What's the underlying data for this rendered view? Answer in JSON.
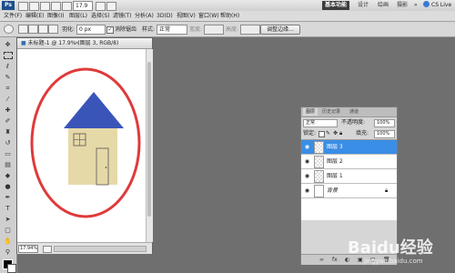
{
  "app": {
    "logo_text": "Ps",
    "zoom": "17.9",
    "workspaces": [
      "基本功能",
      "设计",
      "绘画",
      "摄影"
    ],
    "more_label": "»",
    "cs_live": "CS Live"
  },
  "menu": [
    "文件(F)",
    "编辑(E)",
    "图像(I)",
    "图层(L)",
    "选择(S)",
    "滤镜(T)",
    "分析(A)",
    "3D(D)",
    "视图(V)",
    "窗口(W)",
    "帮助(H)"
  ],
  "options": {
    "feather_label": "羽化:",
    "feather_value": "0 px",
    "antialias_label": "消除锯齿",
    "style_label": "样式:",
    "style_value": "正常",
    "width_label": "宽度:",
    "height_label": "高度:",
    "refine_label": "调整边缘..."
  },
  "document": {
    "title": "未标题-1 @ 17.9% (图层 3, RGB/8)",
    "close": "×",
    "zoom_status": "17.94%",
    "drawing": {
      "roof_color": "#3a55b8",
      "wall_color": "#e6d9a8",
      "outline_color": "#e03a3a"
    }
  },
  "layers_panel": {
    "tabs": [
      "图层",
      "历史记录",
      "通道"
    ],
    "blend_mode": "正常",
    "opacity_label": "不透明度:",
    "opacity_value": "100%",
    "lock_label": "锁定:",
    "fill_label": "填充:",
    "fill_value": "100%",
    "layers": [
      {
        "name": "图层 3",
        "selected": true
      },
      {
        "name": "图层 2",
        "selected": false
      },
      {
        "name": "图层 1",
        "selected": false
      },
      {
        "name": "背景",
        "selected": false
      }
    ],
    "bottom_buttons": [
      "∞",
      "fx",
      "◐",
      "▣",
      "□",
      "🗑"
    ]
  },
  "watermark": {
    "text": "Baidu经验",
    "sub": "jingyan.baidu.com"
  }
}
